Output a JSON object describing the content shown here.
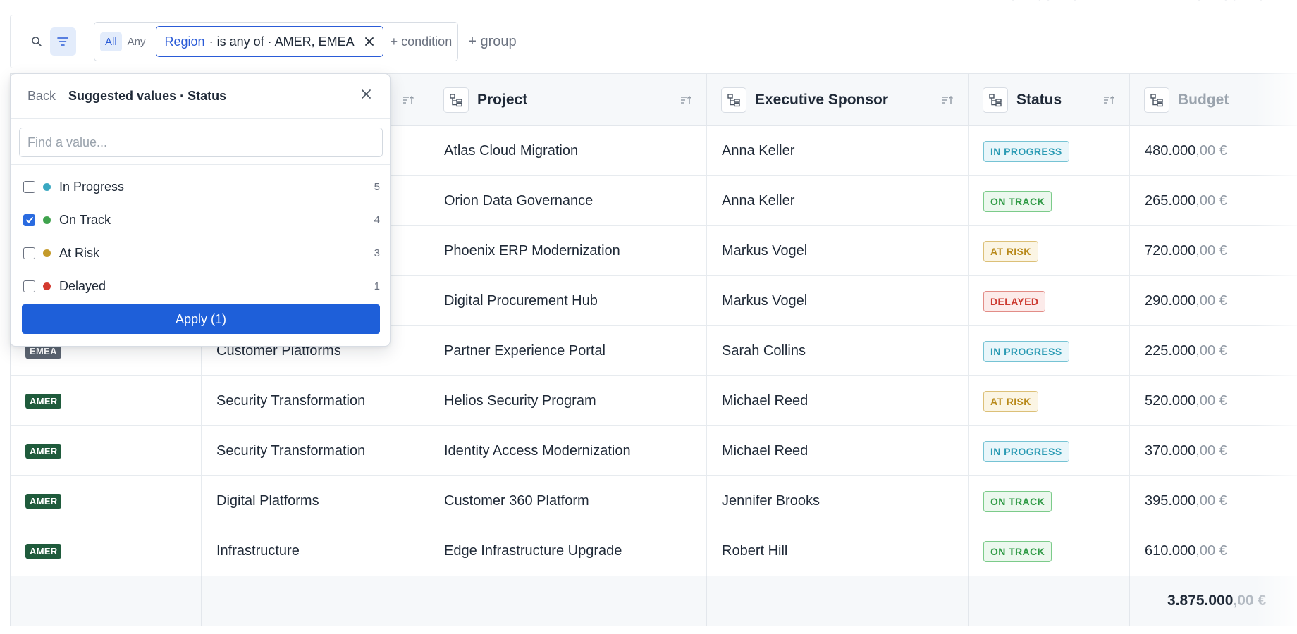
{
  "filter_bar": {
    "search_icon": "search-icon",
    "filter_icon": "filter-icon",
    "mode_all": "All",
    "mode_any": "Any",
    "chip": {
      "field": "Region",
      "rest": "· is any of · AMER, EMEA"
    },
    "add_condition": "+ condition",
    "add_group": "+ group"
  },
  "popover": {
    "back": "Back",
    "title": "Suggested values · Status",
    "search_placeholder": "Find a value...",
    "options": [
      {
        "label": "In Progress",
        "count": "5",
        "checked": false,
        "color": "#3aa8c1"
      },
      {
        "label": "On Track",
        "count": "4",
        "checked": true,
        "color": "#3fa34d"
      },
      {
        "label": "At Risk",
        "count": "3",
        "checked": false,
        "color": "#c49a2a"
      },
      {
        "label": "Delayed",
        "count": "1",
        "checked": false,
        "color": "#d33a2f"
      }
    ],
    "apply": "Apply (1)"
  },
  "table": {
    "columns": {
      "project": "Project",
      "sponsor": "Executive Sponsor",
      "status": "Status",
      "budget": "Budget"
    },
    "rows": [
      {
        "region": "",
        "portfolio": "",
        "project": "Atlas Cloud Migration",
        "sponsor": "Anna Keller",
        "status": "IN PROGRESS",
        "budget_int": "480.000",
        "budget_dec": ",00 €"
      },
      {
        "region": "",
        "portfolio": "",
        "project": "Orion Data Governance",
        "sponsor": "Anna Keller",
        "status": "ON TRACK",
        "budget_int": "265.000",
        "budget_dec": ",00 €"
      },
      {
        "region": "",
        "portfolio": "",
        "project": "Phoenix ERP Modernization",
        "sponsor": "Markus Vogel",
        "status": "AT RISK",
        "budget_int": "720.000",
        "budget_dec": ",00 €"
      },
      {
        "region": "",
        "portfolio": "",
        "project": "Digital Procurement Hub",
        "sponsor": "Markus Vogel",
        "status": "DELAYED",
        "budget_int": "290.000",
        "budget_dec": ",00 €"
      },
      {
        "region": "EMEA",
        "portfolio": "Customer Platforms",
        "project": "Partner Experience Portal",
        "sponsor": "Sarah Collins",
        "status": "IN PROGRESS",
        "budget_int": "225.000",
        "budget_dec": ",00 €"
      },
      {
        "region": "AMER",
        "portfolio": "Security Transformation",
        "project": "Helios Security Program",
        "sponsor": "Michael Reed",
        "status": "AT RISK",
        "budget_int": "520.000",
        "budget_dec": ",00 €"
      },
      {
        "region": "AMER",
        "portfolio": "Security Transformation",
        "project": "Identity Access Modernization",
        "sponsor": "Michael Reed",
        "status": "IN PROGRESS",
        "budget_int": "370.000",
        "budget_dec": ",00 €"
      },
      {
        "region": "AMER",
        "portfolio": "Digital Platforms",
        "project": "Customer 360 Platform",
        "sponsor": "Jennifer Brooks",
        "status": "ON TRACK",
        "budget_int": "395.000",
        "budget_dec": ",00 €"
      },
      {
        "region": "AMER",
        "portfolio": "Infrastructure",
        "project": "Edge Infrastructure Upgrade",
        "sponsor": "Robert Hill",
        "status": "ON TRACK",
        "budget_int": "610.000",
        "budget_dec": ",00 €"
      }
    ],
    "total_int": "3.875.000",
    "total_dec": ",00 €"
  }
}
